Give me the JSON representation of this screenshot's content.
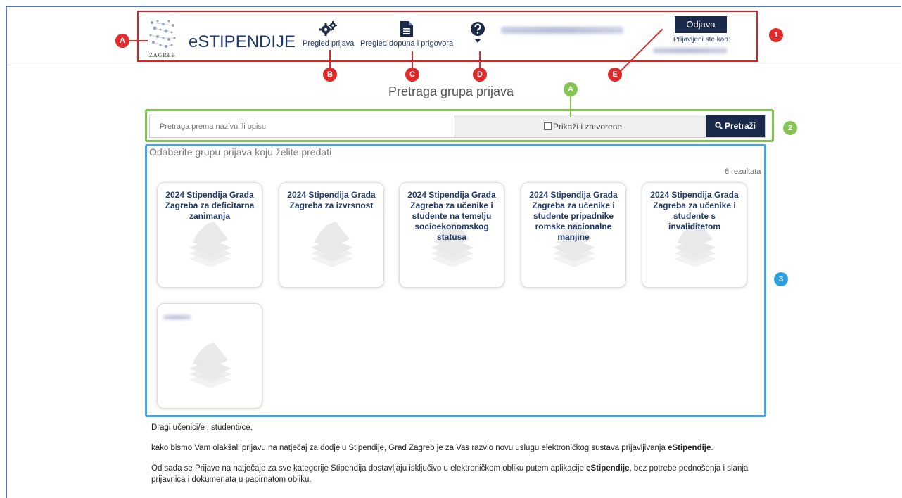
{
  "header": {
    "logo_text": "ZAGREB",
    "app_title": "eSTIPENDIJE",
    "nav": {
      "applications_label": "Pregled prijava",
      "supplements_label": "Pregled dopuna i prigovora"
    },
    "logout_label": "Odjava",
    "logged_in_as_label": "Prijavljeni ste kao:"
  },
  "annotations": {
    "header_letters": [
      "A",
      "B",
      "C",
      "D",
      "E"
    ],
    "header_number": "1",
    "search_letter": "A",
    "search_number": "2",
    "results_number": "3"
  },
  "main": {
    "heading": "Pretraga grupa prijava",
    "search": {
      "placeholder": "Pretraga prema nazivu ili opisu",
      "show_closed_label": "Prikaži i zatvorene",
      "search_button_label": "Pretraži"
    },
    "section_title": "Odaberite grupu prijava koju želite predati",
    "result_count": "6 rezultata",
    "cards": [
      "2024 Stipendija Grada Zagreba za deficitarna zanimanja",
      "2024 Stipendija Grada Zagreba za izvrsnost",
      "2024 Stipendija Grada Zagreba za učenike i studente na temelju socioekonomskog statusa",
      "2024 Stipendija Grada Zagreba za učenike i studente pripadnike romske nacionalne manjine",
      "2024 Stipendija Grada Zagreba za učenike i studente s invaliditetom"
    ]
  },
  "footer": {
    "greeting": "Dragi učenici/e i studenti/ce,",
    "p1_text": "kako bismo Vam olakšali prijavu na natječaj za dodjelu Stipendije, Grad Zagreb je za Vas razvio novu uslugu elektroničkog sustava prijavljivanja ",
    "p1_bold": "eStipendije",
    "p1_end": ".",
    "p2_text": "Od sada se Prijave na natječaje za sve kategorije Stipendija dostavljaju isključivo u elektroničkom obliku putem aplikacije ",
    "p2_bold": "eStipendije",
    "p2_end": ", bez potrebe podnošenja i slanja prijavnica i dokumenata u papirnatom obliku."
  },
  "colors": {
    "accent": "#1b2a4a",
    "annotation_red": "#e12a2a",
    "annotation_green": "#82c553",
    "annotation_blue": "#2aa0de"
  }
}
